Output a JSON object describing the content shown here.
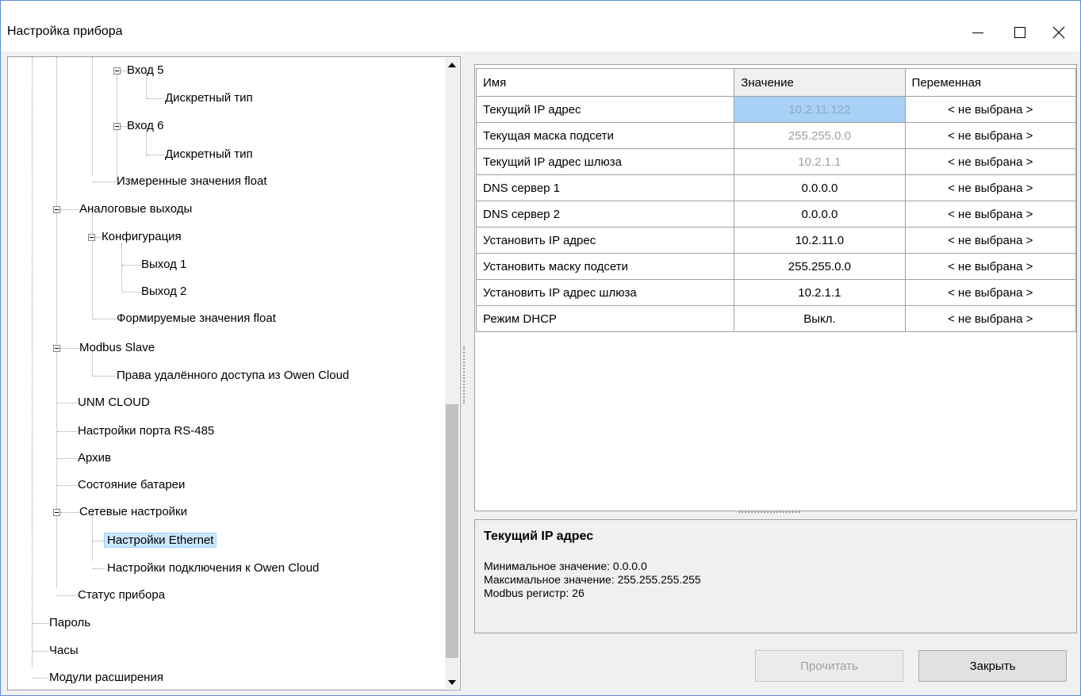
{
  "window": {
    "title": "Настройка прибора",
    "controls": {
      "minimize": "minimize-icon",
      "maximize": "maximize-icon",
      "close": "close-icon"
    }
  },
  "tree": {
    "nodes": [
      {
        "label": "Вход 5"
      },
      {
        "label": "Дискретный тип"
      },
      {
        "label": "Вход 6"
      },
      {
        "label": "Дискретный тип"
      },
      {
        "label": "Измеренные значения float"
      },
      {
        "label": "Аналоговые выходы"
      },
      {
        "label": "Конфигурация"
      },
      {
        "label": "Выход 1"
      },
      {
        "label": "Выход 2"
      },
      {
        "label": "Формируемые значения float"
      },
      {
        "label": "Modbus Slave"
      },
      {
        "label": "Права удалённого доступа из Owen Cloud"
      },
      {
        "label": "UNM CLOUD"
      },
      {
        "label": "Настройки порта RS-485"
      },
      {
        "label": "Архив"
      },
      {
        "label": "Состояние батареи"
      },
      {
        "label": "Сетевые настройки"
      },
      {
        "label": "Настройки Ethernet"
      },
      {
        "label": "Настройки подключения к Owen Cloud"
      },
      {
        "label": "Статус прибора"
      },
      {
        "label": "Пароль"
      },
      {
        "label": "Часы"
      },
      {
        "label": "Модули расширения"
      }
    ],
    "selected": "Настройки Ethernet"
  },
  "grid": {
    "headers": {
      "name": "Имя",
      "value": "Значение",
      "variable": "Переменная"
    },
    "rows": [
      {
        "name": "Текущий IP адрес",
        "value": "10.2.11.122",
        "variable": "< не выбрана >"
      },
      {
        "name": "Текущая маска подсети",
        "value": "255.255.0.0",
        "variable": "< не выбрана >"
      },
      {
        "name": "Текущий IP адрес шлюза",
        "value": "10.2.1.1",
        "variable": "< не выбрана >"
      },
      {
        "name": "DNS сервер 1",
        "value": "0.0.0.0",
        "variable": "< не выбрана >"
      },
      {
        "name": "DNS сервер 2",
        "value": "0.0.0.0",
        "variable": "< не выбрана >"
      },
      {
        "name": "Установить IP адрес",
        "value": "10.2.11.0",
        "variable": "< не выбрана >"
      },
      {
        "name": "Установить маску подсети",
        "value": "255.255.0.0",
        "variable": "< не выбрана >"
      },
      {
        "name": "Установить IP адрес шлюза",
        "value": "10.2.1.1",
        "variable": "< не выбрана >"
      },
      {
        "name": "Режим DHCP",
        "value": "Выкл.",
        "variable": "< не выбрана >"
      }
    ]
  },
  "description": {
    "title": "Текущий IP адрес",
    "min": "Минимальное значение: 0.0.0.0",
    "max": "Максимальное значение: 255.255.255.255",
    "register": "Modbus регистр: 26"
  },
  "buttons": {
    "read": "Прочитать",
    "close": "Закрыть"
  },
  "colors": {
    "selection": "#cce8ff",
    "cell_selected": "#a9d1f5",
    "border": "#a0a0a0"
  }
}
